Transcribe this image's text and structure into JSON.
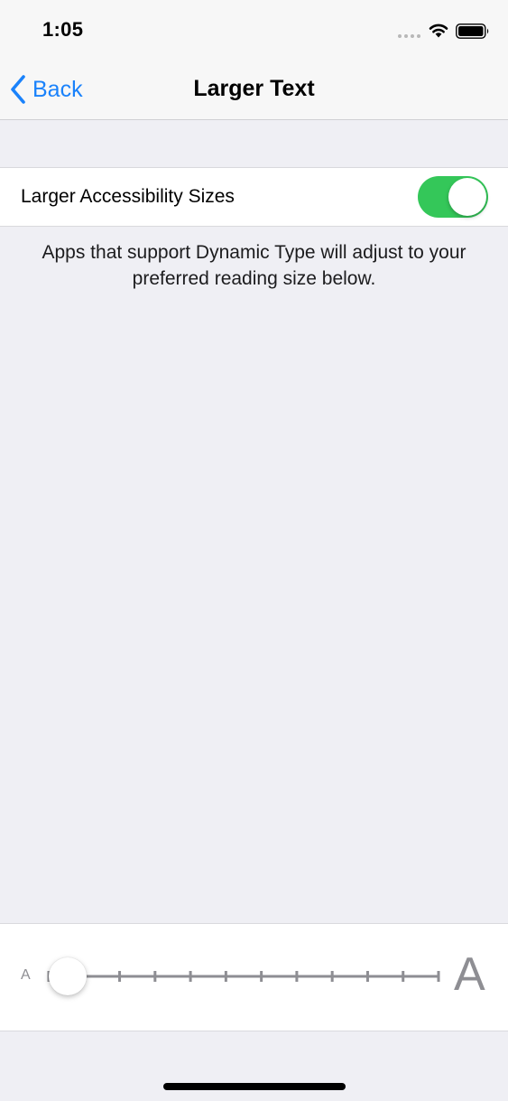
{
  "status_bar": {
    "time": "1:05"
  },
  "nav": {
    "back_label": "Back",
    "title": "Larger Text"
  },
  "toggle_row": {
    "label": "Larger Accessibility Sizes",
    "enabled": true,
    "on_color": "#34c759"
  },
  "description": "Apps that support Dynamic Type will adjust to your preferred reading size below.",
  "text_size_slider": {
    "small_label": "A",
    "large_label": "A",
    "steps": 12,
    "selected_step": 0
  },
  "colors": {
    "accent": "#1a82fb",
    "background": "#efeff4"
  }
}
